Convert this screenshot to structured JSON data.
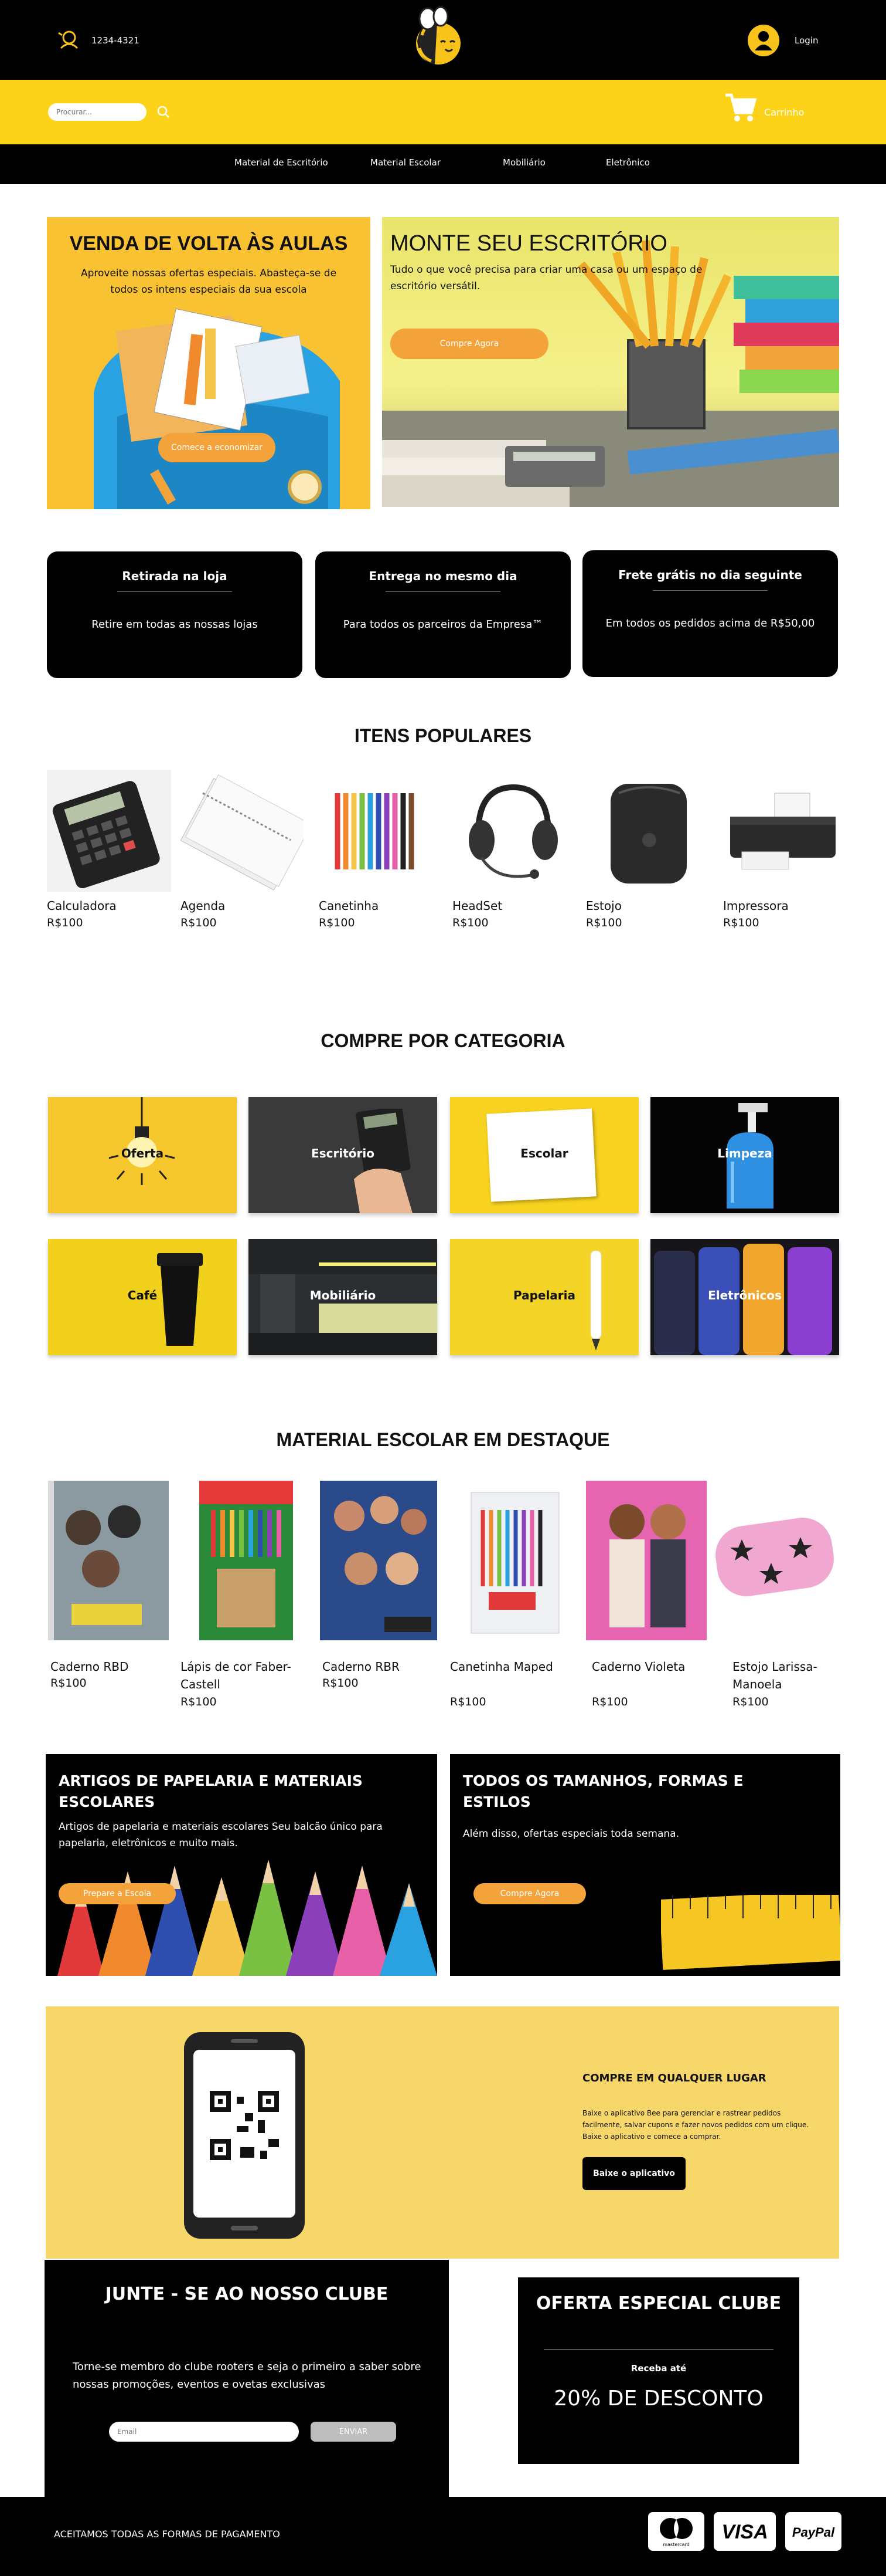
{
  "header": {
    "phone": "1234-4321",
    "login": "Login"
  },
  "search": {
    "placeholder": "Procurar..."
  },
  "cart": {
    "label": "Carrinho"
  },
  "nav": [
    "Material de Escritório",
    "Material Escolar",
    "Mobiliário",
    "Eletrônico"
  ],
  "hero": {
    "left": {
      "title": "VENDA DE VOLTA ÀS AULAS",
      "text": "Aproveite nossas ofertas especiais. Abasteça-se de todos os intens especiais da sua escola",
      "button": "Comece a economizar"
    },
    "right": {
      "title": "MONTE SEU ESCRITÓRIO",
      "text": "Tudo o que você precisa para criar uma casa ou um espaço de escritório versátil.",
      "button": "Compre Agora"
    }
  },
  "services": [
    {
      "title": "Retirada na loja",
      "text": "Retire em todas as nossas lojas"
    },
    {
      "title": "Entrega no mesmo dia",
      "text": "Para todos os parceiros da Empresa™"
    },
    {
      "title": "Frete grátis no dia seguinte",
      "text": "Em todos os pedidos acima de R$50,00"
    }
  ],
  "popular": {
    "title": "ITENS POPULARES",
    "items": [
      {
        "name": "Calculadora",
        "price": "R$100"
      },
      {
        "name": "Agenda",
        "price": "R$100"
      },
      {
        "name": "Canetinha",
        "price": "R$100"
      },
      {
        "name": "HeadSet",
        "price": "R$100"
      },
      {
        "name": "Estojo",
        "price": "R$100"
      },
      {
        "name": "Impressora",
        "price": "R$100"
      }
    ]
  },
  "categories": {
    "title": "COMPRE POR CATEGORIA",
    "items": [
      "Oferta",
      "Escritório",
      "Escolar",
      "Limpeza",
      "Café",
      "Mobiliário",
      "Papelaria",
      "Eletrônicos"
    ]
  },
  "featured": {
    "title": "MATERIAL ESCOLAR EM DESTAQUE",
    "items": [
      {
        "name": "Caderno RBD",
        "price": "R$100"
      },
      {
        "name": "Lápis de cor Faber-Castell",
        "price": "R$100"
      },
      {
        "name": "Caderno RBR",
        "price": "R$100"
      },
      {
        "name": "Canetinha Maped",
        "price": "R$100"
      },
      {
        "name": "Caderno Violeta",
        "price": "R$100"
      },
      {
        "name": "Estojo Larissa-Manoela",
        "price": "R$100"
      }
    ]
  },
  "promos": {
    "left": {
      "title": "ARTIGOS DE PAPELARIA E MATERIAIS ESCOLARES",
      "text": "Artigos de papelaria e materiais escolares Seu balcão único para papelaria, eletrônicos e muito mais.",
      "button": "Prepare a Escola"
    },
    "right": {
      "title": "TODOS OS TAMANHOS, FORMAS E ESTILOS",
      "text": "Além disso, ofertas especiais toda semana.",
      "button": "Compre Agora"
    }
  },
  "app": {
    "title": "COMPRE EM QUALQUER LUGAR",
    "text": "Baixe o aplicativo Bee para gerenciar e rastrear pedidos facilmente, salvar cupons e fazer novos pedidos com um clique. Baixe o aplicativo e comece a comprar.",
    "button": "Baixe o aplicativo"
  },
  "club": {
    "title": "JUNTE - SE AO NOSSO CLUBE",
    "text": "Torne-se membro do clube rooters e seja o primeiro a saber sobre nossas promoções, eventos e ovetas exclusivas",
    "email_placeholder": "Email",
    "send": "ENVIAR"
  },
  "offer": {
    "title": "OFERTA ESPECIAL CLUBE",
    "pre": "Receba até",
    "discount": "20% DE DESCONTO"
  },
  "footer": {
    "text": "ACEITAMOS TODAS AS FORMAS DE PAGAMENTO",
    "payments": [
      "mastercard",
      "VISA",
      "PayPal"
    ]
  },
  "colors": {
    "yellow": "#fdd319",
    "orange": "#f3a33a",
    "black": "#000000",
    "app_bg": "#f8d76a"
  }
}
